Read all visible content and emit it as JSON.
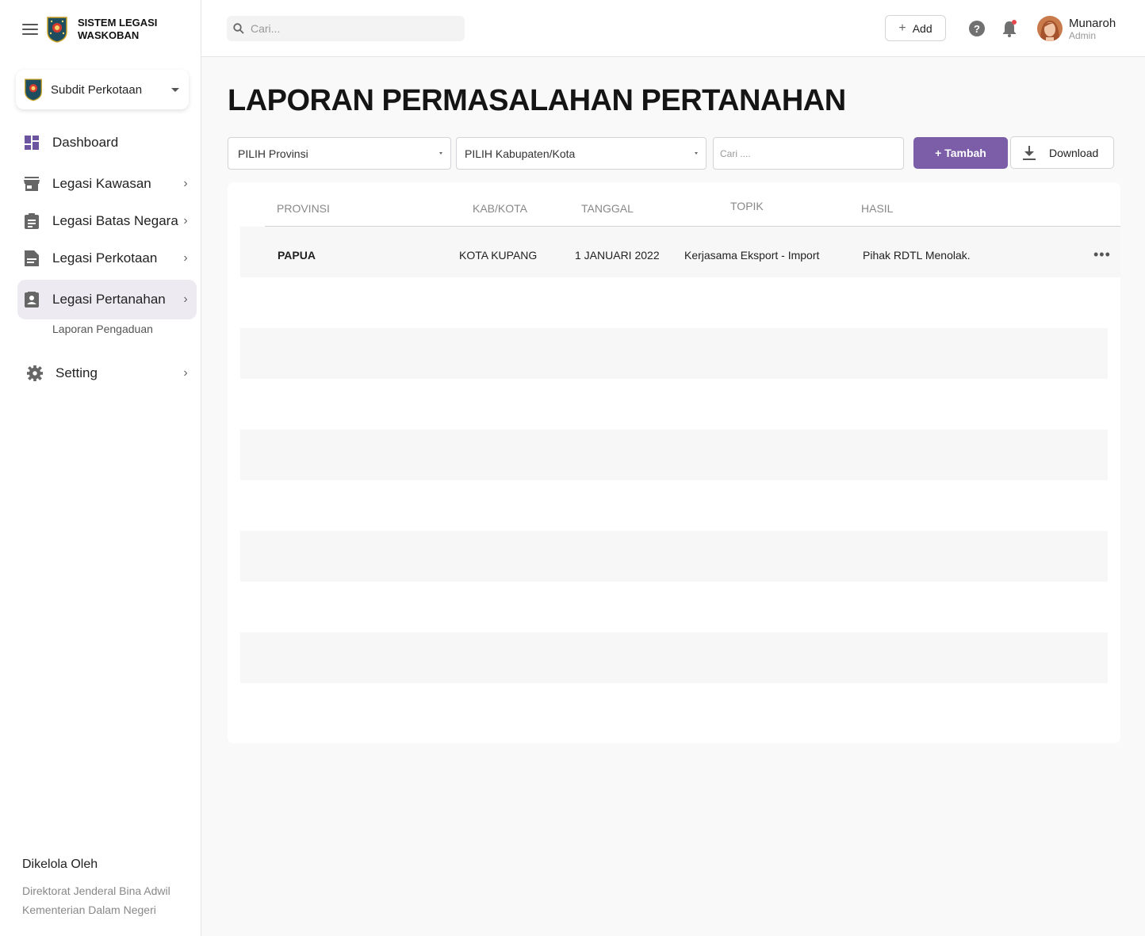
{
  "app": {
    "brand_line1": "SISTEM LEGASI",
    "brand_line2": "WASKOBAN"
  },
  "sidebar": {
    "org_switcher": "Subdit Perkotaan",
    "items": [
      {
        "label": "Dashboard",
        "icon": "dashboard-icon"
      },
      {
        "label": "Legasi Kawasan",
        "icon": "store-icon"
      },
      {
        "label": "Legasi Batas Negara",
        "icon": "clipboard-icon"
      },
      {
        "label": "Legasi Perkotaan",
        "icon": "document-icon"
      },
      {
        "label": "Legasi Pertanahan",
        "icon": "contact-icon",
        "active": true
      },
      {
        "label": "Setting",
        "icon": "gear-icon"
      }
    ],
    "subitem": "Laporan Pengaduan",
    "managed_title": "Dikelola Oleh",
    "managed_line1": "Direktorat Jenderal Bina Adwil",
    "managed_line2": "Kementerian Dalam Negeri"
  },
  "topbar": {
    "search_placeholder": "Cari...",
    "add_label": "Add",
    "user_name": "Munaroh",
    "user_role": "Admin"
  },
  "main": {
    "title": "LAPORAN PERMASALAHAN PERTANAHAN",
    "province_select": "PILIH Provinsi",
    "city_select": "PILIH Kabupaten/Kota",
    "filter_placeholder": "Cari ....",
    "tambah_label": "+ Tambah",
    "download_label": "Download"
  },
  "table": {
    "columns": [
      "PROVINSI",
      "KAB/KOTA",
      "TANGGAL",
      "TOPIK",
      "HASIL"
    ],
    "rows": [
      {
        "provinsi": "PAPUA",
        "kabkota": "KOTA KUPANG",
        "tanggal": "1 JANUARI 2022",
        "topik": "Kerjasama Eksport - Import",
        "hasil": "Pihak RDTL Menolak."
      }
    ]
  },
  "colors": {
    "accent": "#7b5ea7",
    "active_nav_bg": "#eeeaf2",
    "notification_dot": "#e5484d"
  }
}
